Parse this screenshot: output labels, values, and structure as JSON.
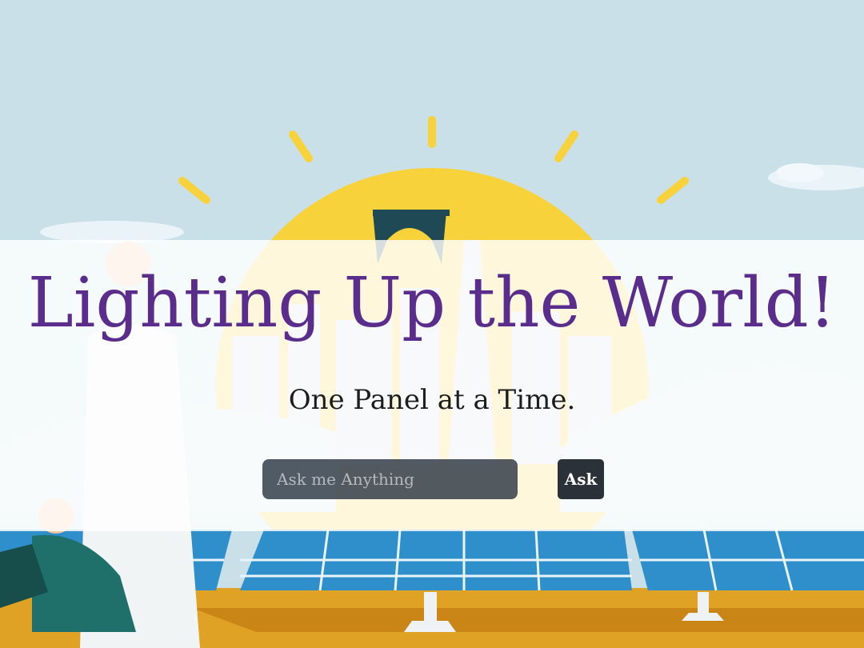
{
  "hero": {
    "title": "Lighting Up the World!",
    "subtitle": "One Panel at a Time."
  },
  "search": {
    "placeholder": "Ask me Anything",
    "value": ""
  },
  "actions": {
    "ask_label": "Ask"
  },
  "colors": {
    "sky": "#c9e0e8",
    "sun": "#f7d23a",
    "title": "#5a2d8c",
    "panel": "#2f8fcb",
    "ground": "#e0a224",
    "person_teal": "#1f6f6b"
  }
}
